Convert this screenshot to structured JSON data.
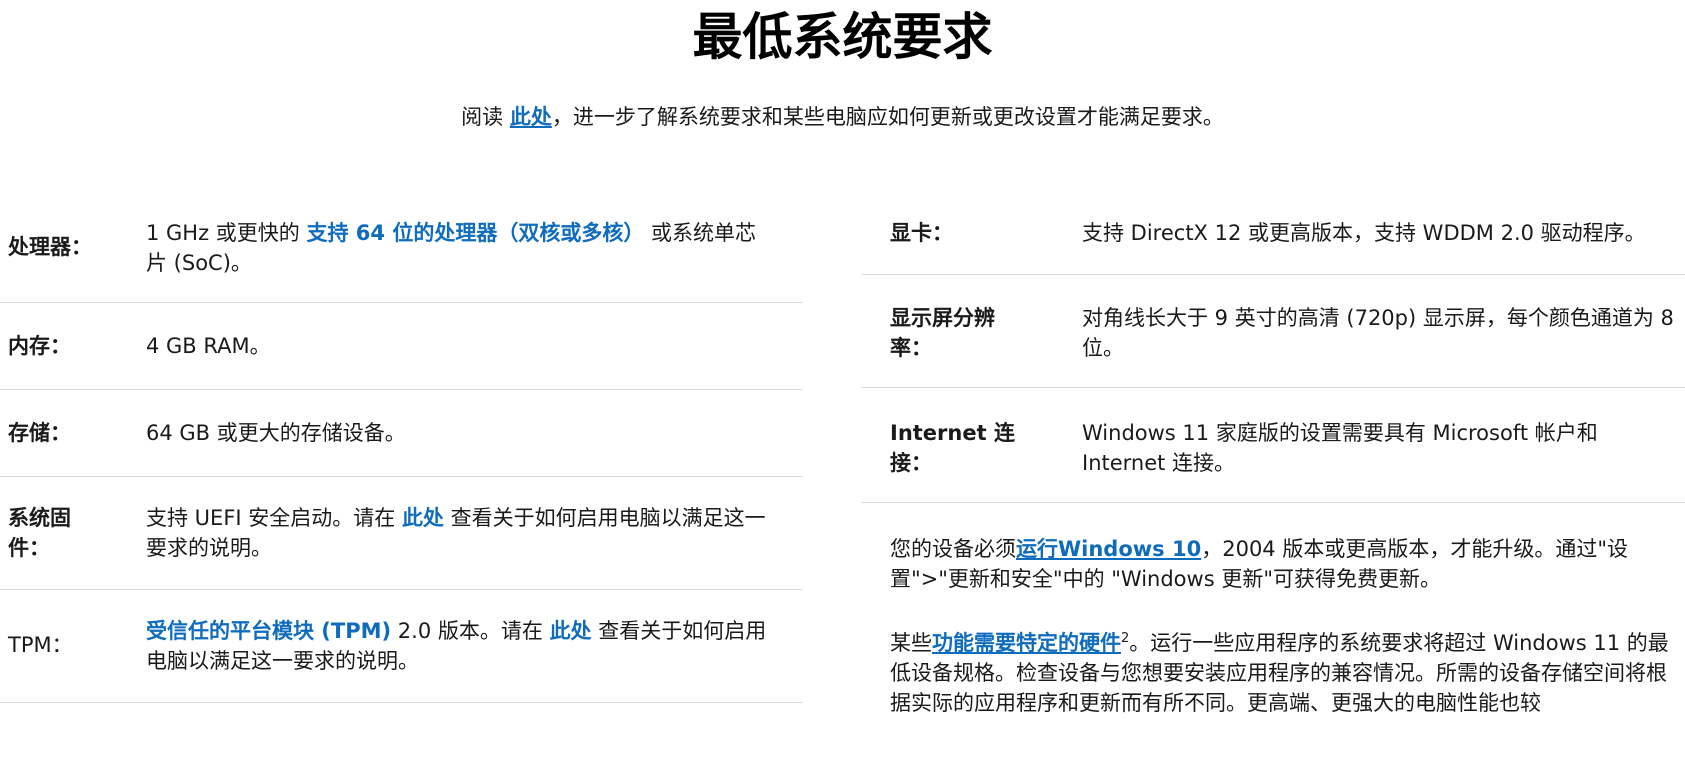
{
  "page": {
    "title": "最低系统要求",
    "intro": {
      "prefix": "阅读 ",
      "link": "此处",
      "suffix": "，进一步了解系统要求和某些电脑应如何更新或更改设置才能满足要求。"
    }
  },
  "left_rows": [
    {
      "label": "处理器：",
      "pre": "1 GHz 或更快的 ",
      "link": "支持 64 位的处理器（双核或多核）",
      "post": " 或系统单芯片 (SoC)。"
    },
    {
      "label": "内存：",
      "text": "4 GB RAM。"
    },
    {
      "label": "存储：",
      "text": "64 GB 或更大的存储设备。"
    },
    {
      "label": "系统固件：",
      "pre": "支持 UEFI 安全启动。请在 ",
      "link": "此处",
      "post": " 查看关于如何启用电脑以满足这一要求的说明。"
    },
    {
      "label": "TPM：",
      "pre": "",
      "link": "受信任的平台模块 (TPM)",
      "post": " 2.0 版本。请在 ",
      "link2": "此处",
      "post2": " 查看关于如何启用电脑以满足这一要求的说明。"
    }
  ],
  "right_rows": [
    {
      "label": "显卡：",
      "text": "支持 DirectX 12 或更高版本，支持 WDDM 2.0 驱动程序。"
    },
    {
      "label": "显示屏分辨率：",
      "text": "对角线长大于 9 英寸的高清 (720p) 显示屏，每个颜色通道为 8 位。"
    },
    {
      "label": "Internet 连接：",
      "text": "Windows 11 家庭版的设置需要具有 Microsoft 帐户和 Internet 连接。"
    }
  ],
  "notes": {
    "upgrade": {
      "pre": "您的设备必须",
      "link": "运行Windows 10",
      "post": "，2004 版本或更高版本，才能升级。通过\"设置\">\"更新和安全\"中的 \"Windows 更新\"可获得免费更新。"
    },
    "features": {
      "pre": "某些",
      "link": "功能需要特定的硬件",
      "sup": "2",
      "post": "。运行一些应用程序的系统要求将超过 Windows 11 的最低设备规格。检查设备与您想要安装应用程序的兼容情况。所需的设备存储空间将根据实际的应用程序和更新而有所不同。更高端、更强大的电脑性能也较"
    }
  },
  "colors": {
    "link": "#0f6cbd",
    "divider": "#d9d9d9"
  }
}
